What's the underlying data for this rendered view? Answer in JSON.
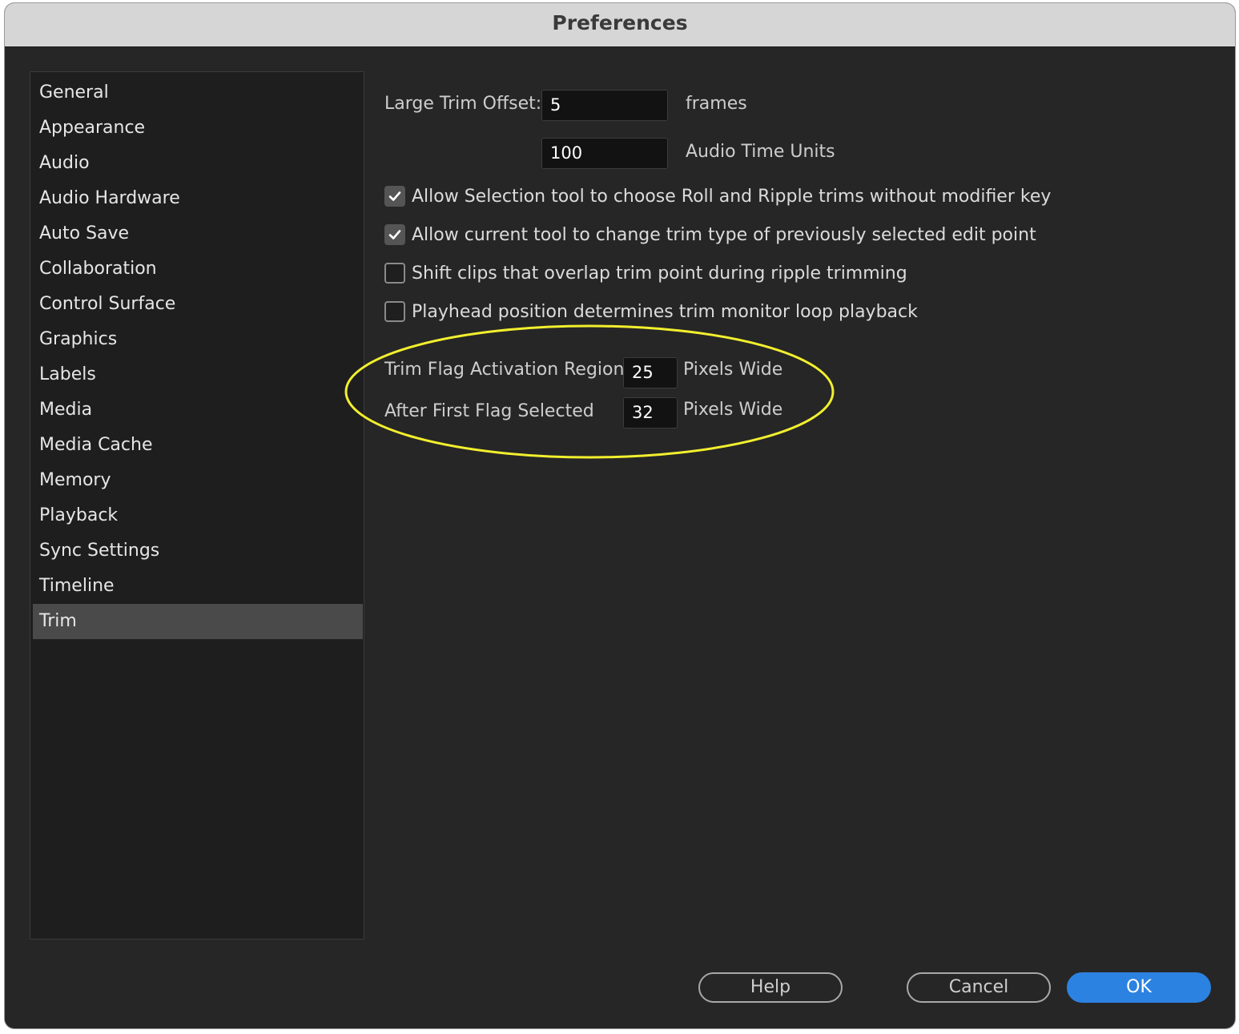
{
  "window": {
    "title": "Preferences"
  },
  "sidebar": {
    "items": [
      {
        "label": "General"
      },
      {
        "label": "Appearance"
      },
      {
        "label": "Audio"
      },
      {
        "label": "Audio Hardware"
      },
      {
        "label": "Auto Save"
      },
      {
        "label": "Collaboration"
      },
      {
        "label": "Control Surface"
      },
      {
        "label": "Graphics"
      },
      {
        "label": "Labels"
      },
      {
        "label": "Media"
      },
      {
        "label": "Media Cache"
      },
      {
        "label": "Memory"
      },
      {
        "label": "Playback"
      },
      {
        "label": "Sync Settings"
      },
      {
        "label": "Timeline"
      },
      {
        "label": "Trim",
        "selected": true
      }
    ]
  },
  "trim": {
    "large_offset_label": "Large Trim Offset:",
    "frames_value": "5",
    "frames_unit": "frames",
    "audio_value": "100",
    "audio_unit": "Audio Time Units",
    "options": [
      {
        "label": "Allow Selection tool to choose Roll and Ripple trims without modifier key",
        "checked": true
      },
      {
        "label": "Allow current tool to change trim type of previously selected edit point",
        "checked": true
      },
      {
        "label": "Shift clips that overlap trim point during ripple trimming",
        "checked": false
      },
      {
        "label": "Playhead position determines trim monitor loop playback",
        "checked": false
      }
    ],
    "flag_region_label": "Trim Flag Activation Region",
    "flag_region_value": "25",
    "flag_region_unit": "Pixels Wide",
    "after_flag_label": "After First Flag Selected",
    "after_flag_value": "32",
    "after_flag_unit": "Pixels Wide"
  },
  "buttons": {
    "help": "Help",
    "cancel": "Cancel",
    "ok": "OK"
  },
  "colors": {
    "highlight_ring": "#f2ef2e",
    "primary_button": "#2c82e0",
    "selected_item": "#4a4a4a"
  },
  "icons": {
    "checkmark": "checkmark-icon"
  }
}
